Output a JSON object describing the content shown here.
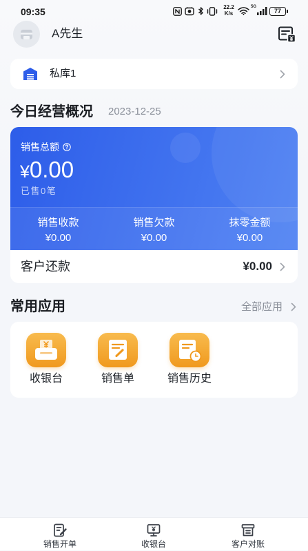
{
  "theme": {
    "primary": "#2D5DE9",
    "primary_light": "#4F82F3",
    "app_icon_top": "#F8BB4E",
    "app_icon_bottom": "#F0991E",
    "background": "#F4F6FA"
  },
  "status_bar": {
    "time": "09:35",
    "net_speed": "22.2",
    "net_speed_unit": "K/s",
    "network_type": "5G",
    "battery_level": "77",
    "icons": [
      "nfc-icon",
      "app-notification-icon",
      "bluetooth-icon",
      "vibrate-icon",
      "wifi-icon",
      "cellular-signal-icon",
      "battery-icon"
    ]
  },
  "header": {
    "user_name": "A先生",
    "avatar_icon": "store-avatar-icon",
    "action_icon": "invoice-icon"
  },
  "warehouse": {
    "name": "私库1",
    "icon": "warehouse-icon",
    "arrow_icon": "chevron-right-icon"
  },
  "overview": {
    "title": "今日经营概况",
    "date": "2023-12-25",
    "total_sales": {
      "label": "销售总额",
      "help_icon": "question-circle-icon",
      "currency": "¥",
      "value": "0.00",
      "sold_count": "已售0笔"
    },
    "metrics": [
      {
        "label": "销售收款",
        "value": "¥0.00"
      },
      {
        "label": "销售欠款",
        "value": "¥0.00"
      },
      {
        "label": "抹零金额",
        "value": "¥0.00"
      }
    ],
    "repayment": {
      "label": "客户还款",
      "value": "¥0.00"
    }
  },
  "apps": {
    "title": "常用应用",
    "all_label": "全部应用",
    "items": [
      {
        "label": "收银台",
        "icon": "cashier-icon"
      },
      {
        "label": "销售单",
        "icon": "sales-order-icon"
      },
      {
        "label": "销售历史",
        "icon": "sales-history-icon"
      }
    ]
  },
  "bottom_nav": {
    "items": [
      {
        "label": "销售开单",
        "icon": "create-sales-order-icon"
      },
      {
        "label": "收银台",
        "icon": "cashier-monitor-icon"
      },
      {
        "label": "客户对账",
        "icon": "customer-reconciliation-icon"
      }
    ]
  }
}
